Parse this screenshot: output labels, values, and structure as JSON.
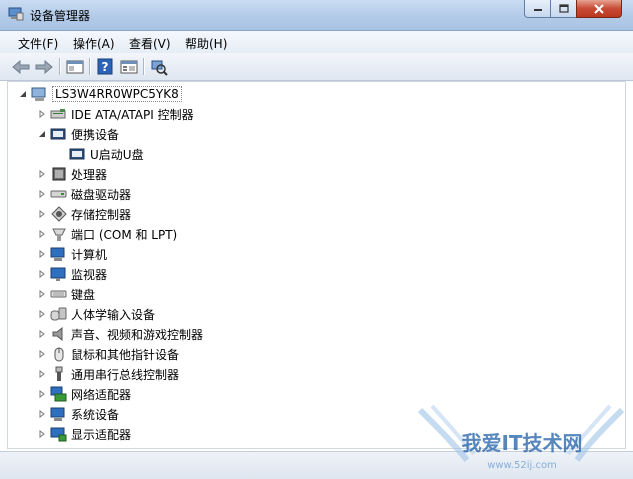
{
  "window": {
    "title": "设备管理器"
  },
  "menu": [
    "文件(F)",
    "操作(A)",
    "查看(V)",
    "帮助(H)"
  ],
  "toolbar": {
    "buttons": [
      "back-icon",
      "forward-icon",
      "properties-view-icon",
      "help-icon",
      "show-hidden-icon",
      "scan-hardware-icon"
    ]
  },
  "tree": {
    "root": "LS3W4RR0WPC5YK8",
    "items": [
      {
        "label": "IDE ATA/ATAPI 控制器",
        "icon": "ide-controller-icon",
        "expanded": false
      },
      {
        "label": "便携设备",
        "icon": "portable-device-icon",
        "expanded": true
      },
      {
        "label": "U启动U盘",
        "icon": "usb-drive-icon",
        "child": true
      },
      {
        "label": "处理器",
        "icon": "processor-icon",
        "expanded": false
      },
      {
        "label": "磁盘驱动器",
        "icon": "disk-drive-icon",
        "expanded": false
      },
      {
        "label": "存储控制器",
        "icon": "storage-controller-icon",
        "expanded": false
      },
      {
        "label": "端口 (COM 和 LPT)",
        "icon": "port-icon",
        "expanded": false
      },
      {
        "label": "计算机",
        "icon": "computer-icon",
        "expanded": false
      },
      {
        "label": "监视器",
        "icon": "monitor-icon",
        "expanded": false
      },
      {
        "label": "键盘",
        "icon": "keyboard-icon",
        "expanded": false
      },
      {
        "label": "人体学输入设备",
        "icon": "hid-icon",
        "expanded": false
      },
      {
        "label": "声音、视频和游戏控制器",
        "icon": "sound-icon",
        "expanded": false
      },
      {
        "label": "鼠标和其他指针设备",
        "icon": "mouse-icon",
        "expanded": false
      },
      {
        "label": "通用串行总线控制器",
        "icon": "usb-controller-icon",
        "expanded": false
      },
      {
        "label": "网络适配器",
        "icon": "network-adapter-icon",
        "expanded": false
      },
      {
        "label": "系统设备",
        "icon": "system-device-icon",
        "expanded": false
      },
      {
        "label": "显示适配器",
        "icon": "display-adapter-icon",
        "expanded": false
      }
    ]
  },
  "watermark": {
    "text": "我爱IT技术网",
    "url": "www.52ij.com"
  },
  "colors": {
    "title_gradient": "#b3cbe8",
    "close_button": "#c74b35",
    "accent_blue": "#1f5fa8"
  }
}
